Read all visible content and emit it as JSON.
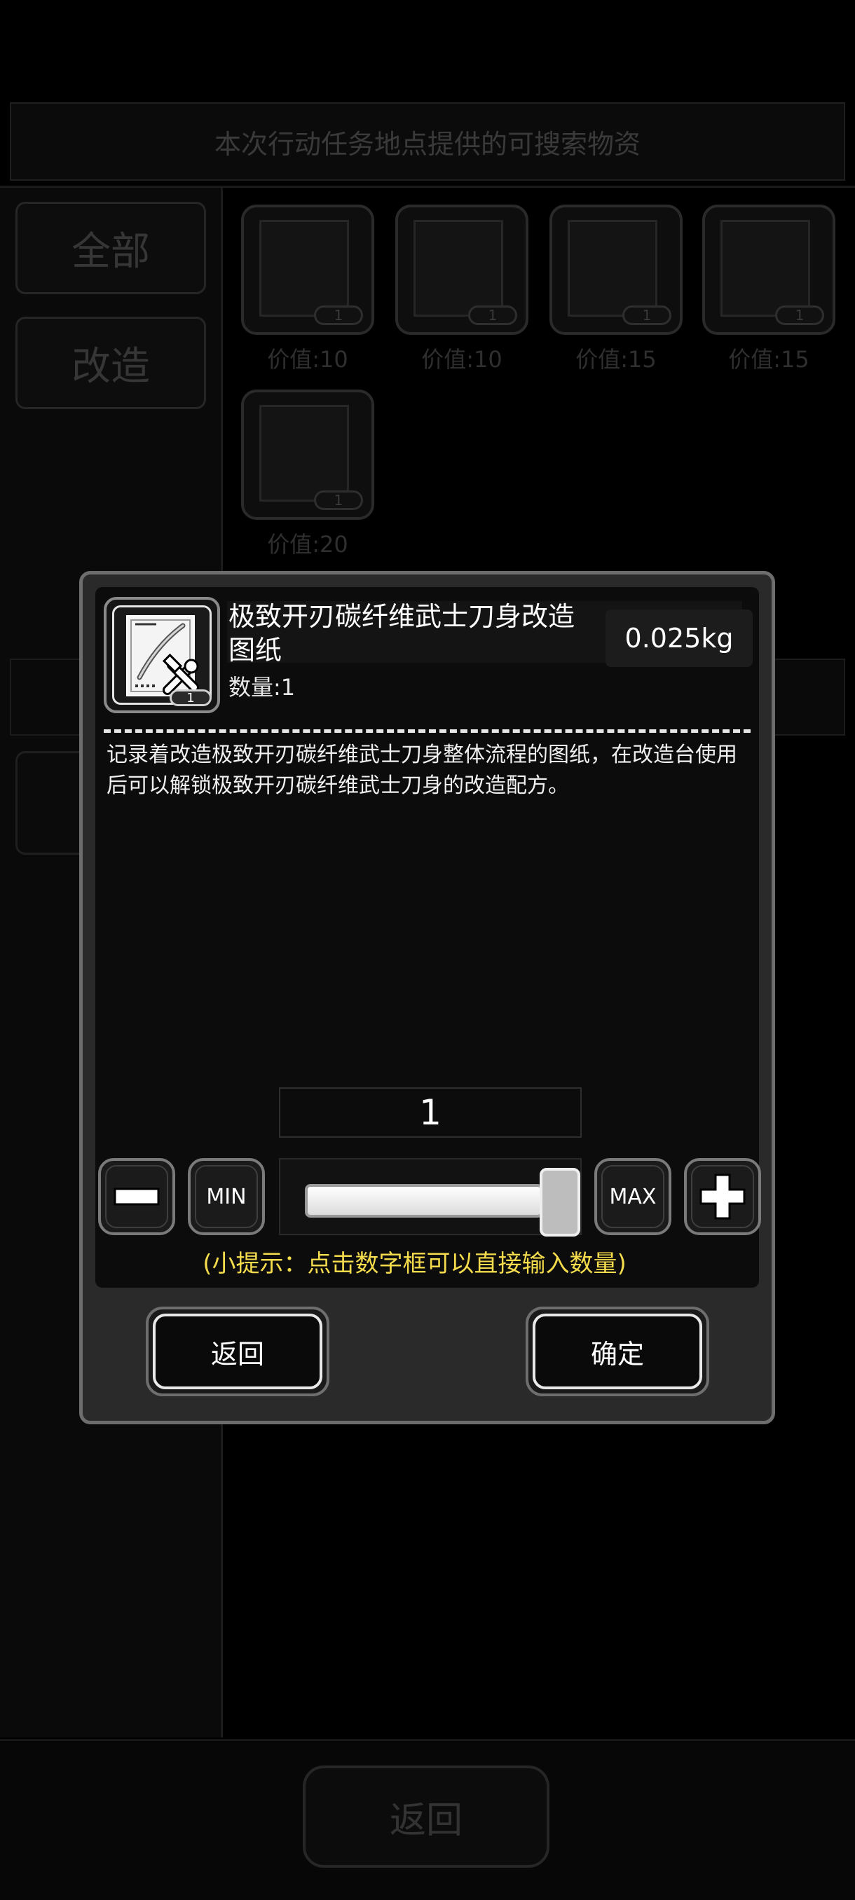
{
  "background": {
    "header_text": "本次行动任务地点提供的可搜索物资",
    "categories": [
      "全部",
      "改造"
    ],
    "items": [
      {
        "value": "价值:10",
        "count": "1"
      },
      {
        "value": "价值:10",
        "count": "1"
      },
      {
        "value": "价值:15",
        "count": "1"
      },
      {
        "value": "价值:15",
        "count": "1"
      },
      {
        "value": "价值:20",
        "count": "1"
      }
    ],
    "back_label": "返回"
  },
  "modal": {
    "item_name": "极致开刃碳纤维武士刀身改造图纸",
    "quantity_label": "数量:1",
    "icon_count": "1",
    "weight": "0.025kg",
    "description": "记录着改造极致开刃碳纤维武士刀身整体流程的图纸，在改造台使用后可以解锁极致开刃碳纤维武士刀身的改造配方。",
    "qty_value": "1",
    "min_label": "MIN",
    "max_label": "MAX",
    "slider_level": 1.0,
    "hint": "(小提示：点击数字框可以直接输入数量)",
    "back_label": "返回",
    "confirm_label": "确定"
  },
  "icons": [
    "blueprint-icon",
    "wrench-hammer-icon",
    "minus-icon",
    "plus-icon"
  ],
  "colors": {
    "hint": "#f5dc4c",
    "modal_bg": "#2a2a2a",
    "overlay": "#000000"
  }
}
